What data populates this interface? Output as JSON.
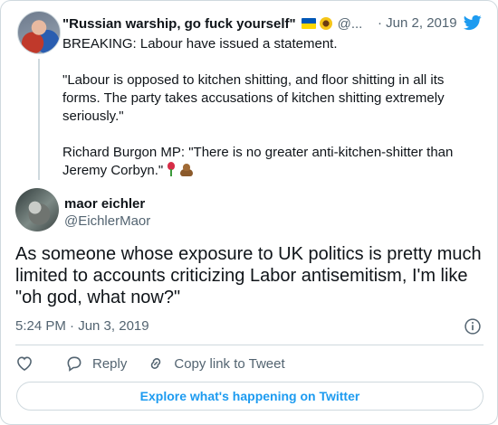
{
  "parent_tweet": {
    "author_name": "\"Russian warship, go fuck yourself\"",
    "flag_icon": "ukraine-flag-icon",
    "sunflower_icon": "sunflower-icon",
    "handle": "@...",
    "date": "· Jun 2, 2019",
    "paragraphs": [
      "BREAKING: Labour have issued a statement.",
      "\"Labour is opposed to kitchen shitting, and floor shitting in all its forms. The party takes accusations of kitchen shitting extremely seriously.\"",
      "Richard Burgon MP: \"There is no greater anti-kitchen-shitter than Jeremy Corbyn.\""
    ],
    "trailing_icons": [
      "rose-icon",
      "poop-icon"
    ]
  },
  "main_tweet": {
    "author_name": "maor eichler",
    "handle": "@EichlerMaor",
    "text": "As someone whose exposure to UK politics is pretty much limited to accounts criticizing Labor antisemitism, I'm like \"oh god, what now?\"",
    "timestamp": "5:24 PM · Jun 3, 2019"
  },
  "actions": {
    "reply_label": "Reply",
    "copy_link_label": "Copy link to Tweet"
  },
  "explore_button": {
    "label": "Explore what's happening on Twitter"
  },
  "colors": {
    "twitter_blue": "#1d9bf0",
    "secondary_text": "#536471",
    "primary_text": "#0f1419",
    "border": "#cfd9de"
  }
}
